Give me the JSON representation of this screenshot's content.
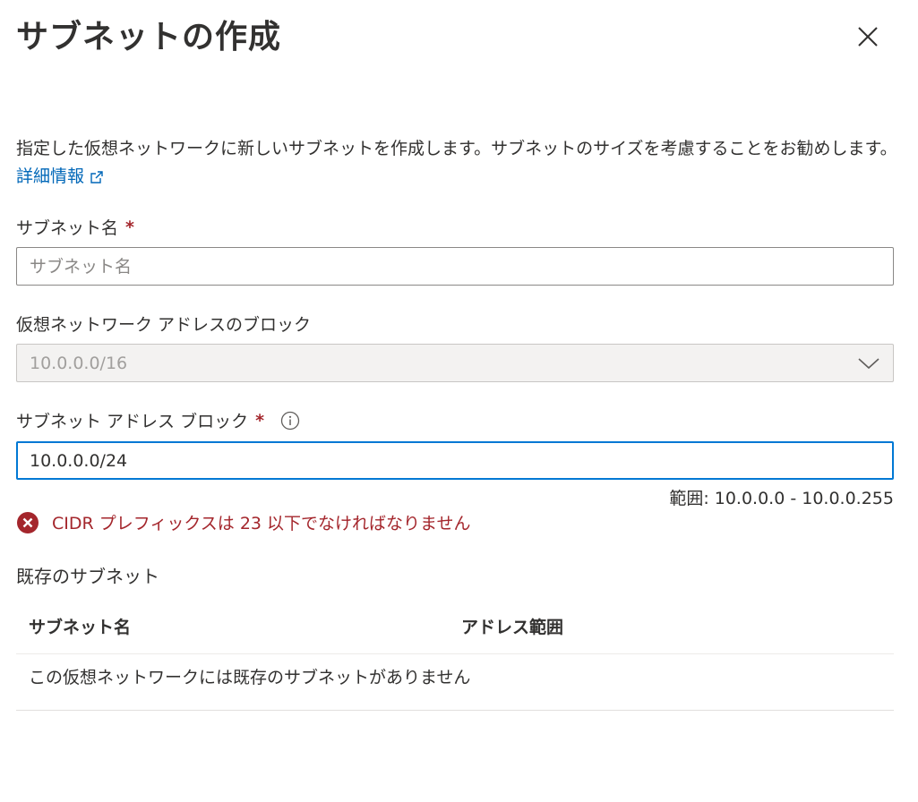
{
  "panel": {
    "title": "サブネットの作成",
    "close_label": "閉じる"
  },
  "description": {
    "text": "指定した仮想ネットワークに新しいサブネットを作成します。サブネットのサイズを考慮することをお勧めします。",
    "learn_more": "詳細情報"
  },
  "fields": {
    "subnet_name": {
      "label": "サブネット名",
      "required_mark": "*",
      "placeholder": "サブネット名",
      "value": ""
    },
    "vnet_address_block": {
      "label": "仮想ネットワーク アドレスのブロック",
      "selected": "10.0.0.0/16",
      "disabled": true
    },
    "subnet_address_block": {
      "label": "サブネット アドレス ブロック",
      "required_mark": "*",
      "value": "10.0.0.0/24",
      "range": "範囲: 10.0.0.0 - 10.0.0.255",
      "error": "CIDR プレフィックスは 23 以下でなければなりません"
    }
  },
  "existing_subnets": {
    "title": "既存のサブネット",
    "columns": [
      "サブネット名",
      "アドレス範囲"
    ],
    "empty_message": "この仮想ネットワークには既存のサブネットがありません"
  },
  "colors": {
    "link": "#0067b8",
    "error": "#a4262c",
    "focus_border": "#0078d4",
    "disabled_bg": "#f3f2f1"
  },
  "icons": {
    "close": "close-icon",
    "external_link": "external-link-icon",
    "info": "info-icon",
    "chevron": "chevron-down-icon",
    "error": "error-circle-icon"
  }
}
